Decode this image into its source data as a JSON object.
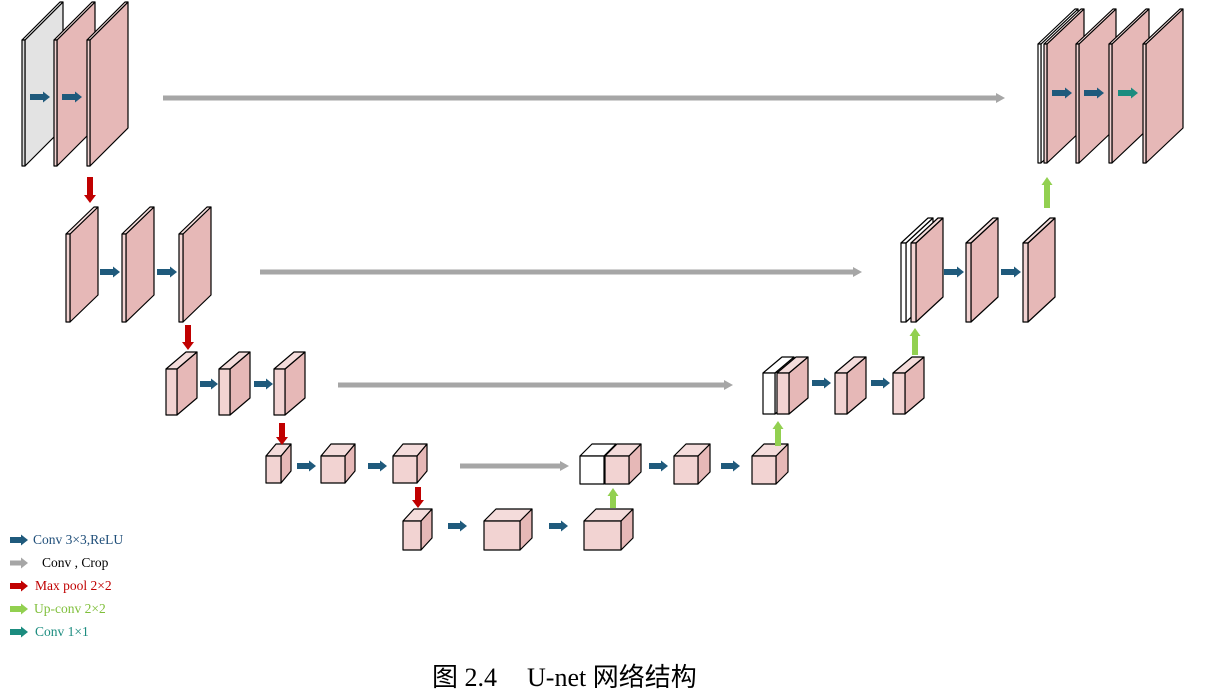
{
  "legend": [
    {
      "label": "Conv 3×3,ReLU",
      "arrow_color": "#1f5a7c",
      "text_color": "#1f4e79"
    },
    {
      "label": "Conv , Crop",
      "arrow_color": "#a6a6a6",
      "text_color": "#000000"
    },
    {
      "label": "Max pool 2×2",
      "arrow_color": "#c00000",
      "text_color": "#c00000"
    },
    {
      "label": "Up-conv 2×2",
      "arrow_color": "#92d050",
      "text_color": "#7fbf3a"
    },
    {
      "label": "Conv 1×1",
      "arrow_color": "#1b8c7f",
      "text_color": "#1b8c7f"
    }
  ],
  "caption": {
    "figure_number": "图 2.4",
    "title": "U-net 网络结构"
  },
  "palette": {
    "outline": "#000000",
    "feature_map_pink": {
      "front": "#f2d3d2",
      "side": "#e6b8b7",
      "top": "#f4dcdb"
    },
    "input_gray": {
      "front": "#d9d9d9",
      "side": "#e3e3e3",
      "top": "#ececec"
    },
    "copied_white": {
      "front": "#ffffff",
      "side": "#ffffff",
      "top": "#ffffff"
    }
  }
}
